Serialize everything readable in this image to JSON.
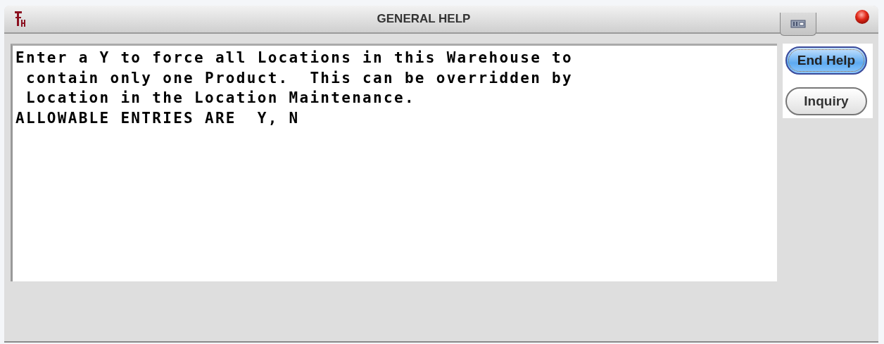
{
  "window": {
    "title": "GENERAL HELP"
  },
  "help_text": {
    "lines": [
      "Enter a Y to force all Locations in this Warehouse to",
      " contain only one Product.  This can be overridden by",
      " Location in the Location Maintenance.",
      "ALLOWABLE ENTRIES ARE  Y, N"
    ]
  },
  "buttons": [
    {
      "label": "End Help",
      "default": true
    },
    {
      "label": "Inquiry",
      "default": false
    }
  ]
}
